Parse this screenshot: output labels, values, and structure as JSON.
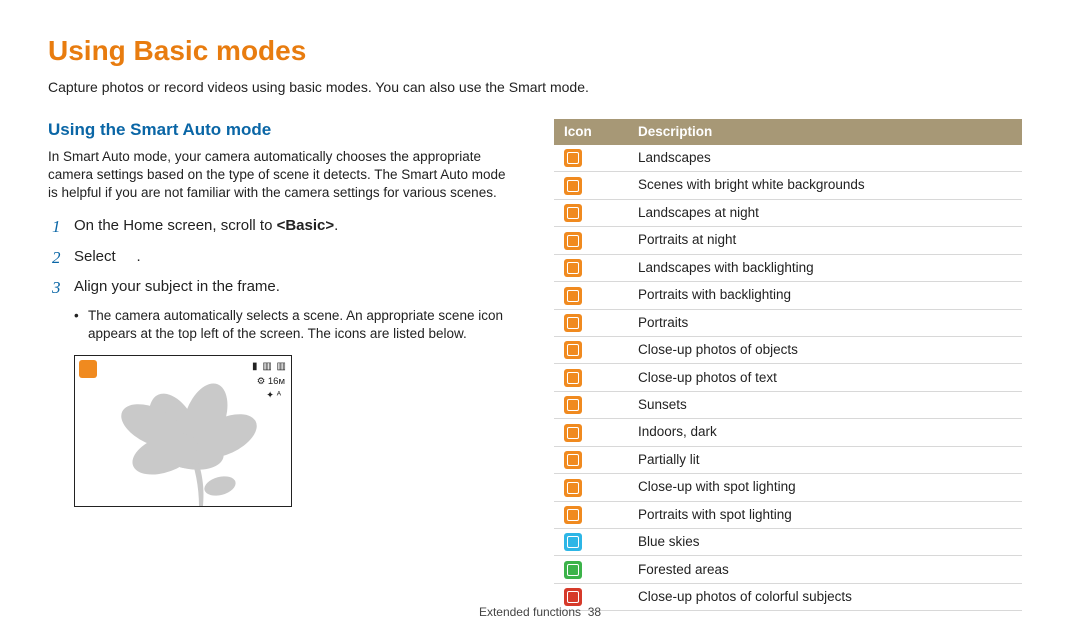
{
  "title": "Using Basic modes",
  "intro": "Capture photos or record videos using basic modes. You can also use the Smart mode.",
  "subtitle": "Using the Smart Auto mode",
  "smart_para": "In Smart Auto mode, your camera automatically chooses the appropriate camera settings based on the type of scene it detects. The Smart Auto mode is helpful if you are not familiar with the camera settings for various scenes.",
  "steps": {
    "s1_pre": "On the Home screen, scroll to ",
    "s1_bold": "<Basic>",
    "s1_post": ".",
    "s2_pre": "Select ",
    "s2_post": " .",
    "s3": "Align your subject in the frame."
  },
  "bullet": "The camera automatically selects a scene. An appropriate scene icon appears at the top left of the screen. The icons are listed below.",
  "preview": {
    "a": "▮ ▥ ▥",
    "b": "⚙ 16ᴍ",
    "c": "✦ ᴬ"
  },
  "table": {
    "h_icon": "Icon",
    "h_desc": "Description",
    "rows": [
      {
        "color": "orange",
        "desc": "Landscapes"
      },
      {
        "color": "orange",
        "desc": "Scenes with bright white backgrounds"
      },
      {
        "color": "orange",
        "desc": "Landscapes at night"
      },
      {
        "color": "orange",
        "desc": "Portraits at night"
      },
      {
        "color": "orange",
        "desc": "Landscapes with backlighting"
      },
      {
        "color": "orange",
        "desc": "Portraits with backlighting"
      },
      {
        "color": "orange",
        "desc": "Portraits"
      },
      {
        "color": "orange",
        "desc": "Close-up photos of objects"
      },
      {
        "color": "orange",
        "desc": "Close-up photos of text"
      },
      {
        "color": "orange",
        "desc": "Sunsets"
      },
      {
        "color": "orange",
        "desc": "Indoors, dark"
      },
      {
        "color": "orange",
        "desc": "Partially lit"
      },
      {
        "color": "orange",
        "desc": "Close-up with spot lighting"
      },
      {
        "color": "orange",
        "desc": "Portraits with spot lighting"
      },
      {
        "color": "cyan",
        "desc": "Blue skies"
      },
      {
        "color": "green",
        "desc": "Forested areas"
      },
      {
        "color": "red",
        "desc": "Close-up photos of colorful subjects"
      }
    ]
  },
  "footer": {
    "section": "Extended functions",
    "page": "38"
  }
}
